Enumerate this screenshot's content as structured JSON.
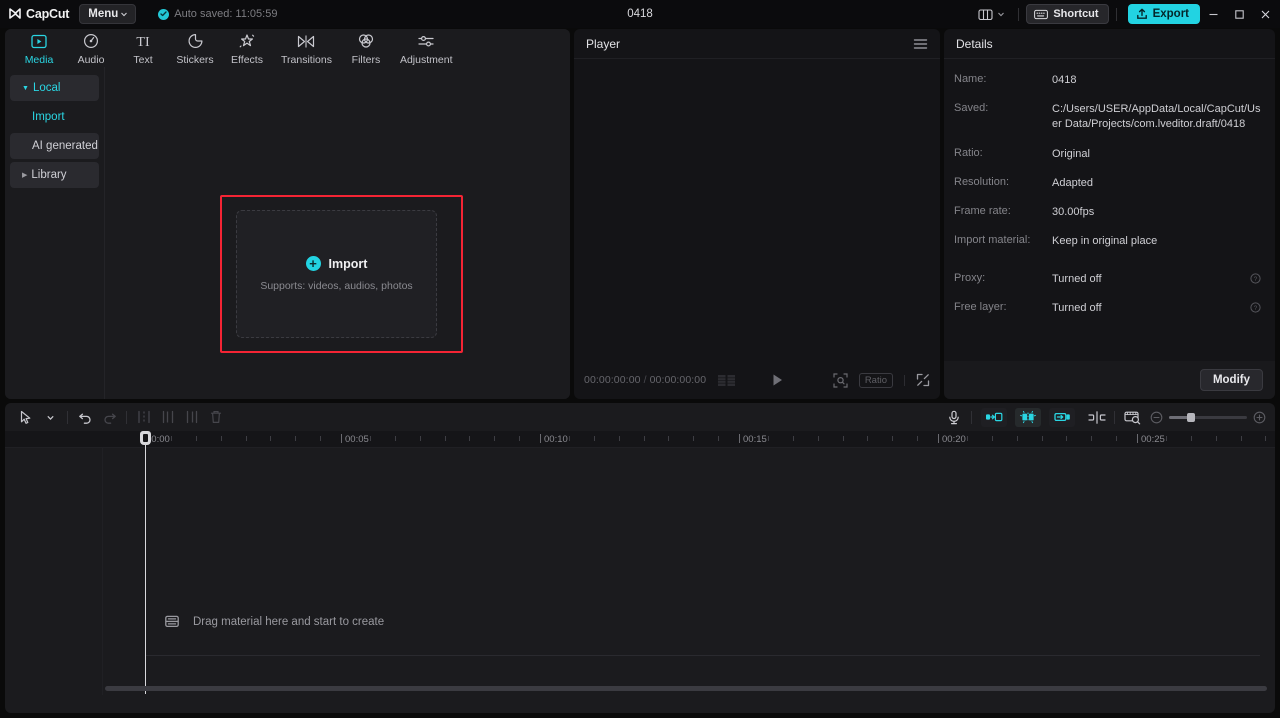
{
  "titlebar": {
    "logo_text": "CapCut",
    "menu_label": "Menu",
    "autosave_text": "Auto saved: 11:05:59",
    "project_title": "0418",
    "shortcut_label": "Shortcut",
    "export_label": "Export",
    "layout_icon": "layout-icon",
    "minimize_icon": "minimize-icon",
    "maximize_icon": "maximize-icon",
    "close_icon": "close-icon",
    "accent_color": "#22d3e2"
  },
  "media": {
    "tabs": [
      {
        "label": "Media",
        "icon": "media-icon",
        "active": true
      },
      {
        "label": "Audio",
        "icon": "audio-icon",
        "active": false
      },
      {
        "label": "Text",
        "icon": "text-icon",
        "active": false
      },
      {
        "label": "Stickers",
        "icon": "stickers-icon",
        "active": false
      },
      {
        "label": "Effects",
        "icon": "effects-icon",
        "active": false
      },
      {
        "label": "Transitions",
        "icon": "transitions-icon",
        "active": false
      },
      {
        "label": "Filters",
        "icon": "filters-icon",
        "active": false
      },
      {
        "label": "Adjustment",
        "icon": "adjustment-icon",
        "active": false
      }
    ],
    "nav": [
      {
        "label": "Local",
        "selected": true,
        "cyan": true,
        "caret": "down",
        "sub": false
      },
      {
        "label": "Import",
        "selected": false,
        "cyan": true,
        "caret": "none",
        "sub": true
      },
      {
        "label": "AI generated",
        "selected": true,
        "cyan": false,
        "caret": "none",
        "sub": true
      },
      {
        "label": "Library",
        "selected": true,
        "cyan": false,
        "caret": "right",
        "sub": false
      }
    ],
    "dropzone": {
      "label": "Import",
      "sublabel": "Supports: videos, audios, photos",
      "plus_icon": "plus-icon",
      "highlight_color": "#f42434"
    }
  },
  "player": {
    "title": "Player",
    "menu_icon": "hamburger-icon",
    "current_time": "00:00:00:00",
    "total_time": "00:00:00:00",
    "separator": "/",
    "play_icon": "play-icon",
    "frames_icon": "frames-icon",
    "ratio_label": "Ratio",
    "crop_icon": "crop-icon",
    "fullscreen_icon": "fullscreen-icon"
  },
  "details": {
    "title": "Details",
    "rows": [
      {
        "key": "Name:",
        "value": "0418",
        "help": false
      },
      {
        "key": "Saved:",
        "value": "C:/Users/USER/AppData/Local/CapCut/User Data/Projects/com.lveditor.draft/0418",
        "help": false
      },
      {
        "key": "Ratio:",
        "value": "Original",
        "help": false
      },
      {
        "key": "Resolution:",
        "value": "Adapted",
        "help": false
      },
      {
        "key": "Frame rate:",
        "value": "30.00fps",
        "help": false
      },
      {
        "key": "Import material:",
        "value": "Keep in original place",
        "help": false
      }
    ],
    "rows2": [
      {
        "key": "Proxy:",
        "value": "Turned off",
        "help": true
      },
      {
        "key": "Free layer:",
        "value": "Turned off",
        "help": true
      }
    ],
    "modify_label": "Modify"
  },
  "timeline": {
    "tools_left": [
      {
        "icon": "select-cursor-icon",
        "dim": false
      },
      {
        "icon": "chevron-down-icon",
        "dim": false
      },
      {
        "icon": "undo-icon",
        "dim": false
      },
      {
        "icon": "redo-icon",
        "dim": true
      },
      {
        "icon": "split-icon",
        "dim": true
      },
      {
        "icon": "trim-left-icon",
        "dim": true
      },
      {
        "icon": "trim-right-icon",
        "dim": true
      },
      {
        "icon": "delete-icon",
        "dim": true
      }
    ],
    "tools_right": [
      {
        "icon": "microphone-icon"
      },
      {
        "icon": "mirror-left-icon"
      },
      {
        "icon": "auto-cut-icon"
      },
      {
        "icon": "mirror-right-icon"
      },
      {
        "icon": "keyframe-icon"
      },
      {
        "icon": "timeline-zoom-icon"
      }
    ],
    "zoom_out_icon": "zoom-out-icon",
    "zoom_in_icon": "zoom-in-icon",
    "ruler_labels": [
      "00:00",
      "00:05",
      "00:10",
      "00:15",
      "00:20",
      "00:25"
    ],
    "playhead_time": "00:00",
    "drop_message": "Drag material here and start to create",
    "drop_icon": "material-icon"
  }
}
